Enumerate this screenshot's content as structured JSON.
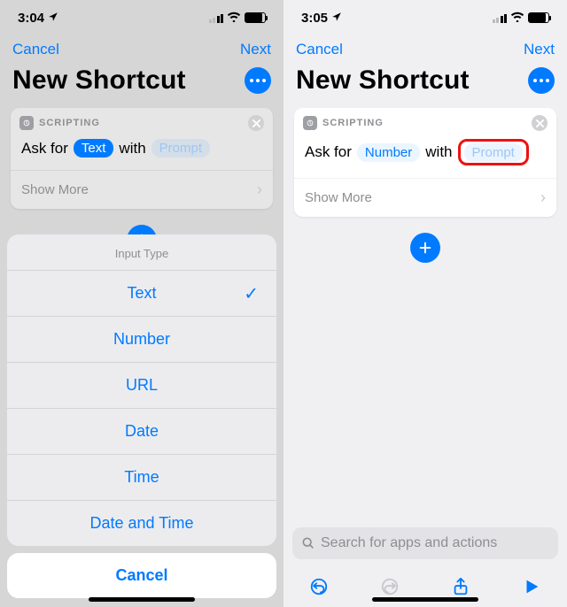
{
  "left": {
    "status_time": "3:04",
    "nav_cancel": "Cancel",
    "nav_next": "Next",
    "page_title": "New Shortcut",
    "card_category": "SCRIPTING",
    "ask_prefix": "Ask for",
    "ask_type": "Text",
    "ask_middle": "with",
    "ask_prompt": "Prompt",
    "show_more": "Show More",
    "sheet_title": "Input Type",
    "sheet_options": {
      "o0": "Text",
      "o1": "Number",
      "o2": "URL",
      "o3": "Date",
      "o4": "Time",
      "o5": "Date and Time"
    },
    "sheet_cancel": "Cancel"
  },
  "right": {
    "status_time": "3:05",
    "nav_cancel": "Cancel",
    "nav_next": "Next",
    "page_title": "New Shortcut",
    "card_category": "SCRIPTING",
    "ask_prefix": "Ask for",
    "ask_type": "Number",
    "ask_middle": "with",
    "ask_prompt": "Prompt",
    "show_more": "Show More",
    "search_placeholder": "Search for apps and actions"
  }
}
